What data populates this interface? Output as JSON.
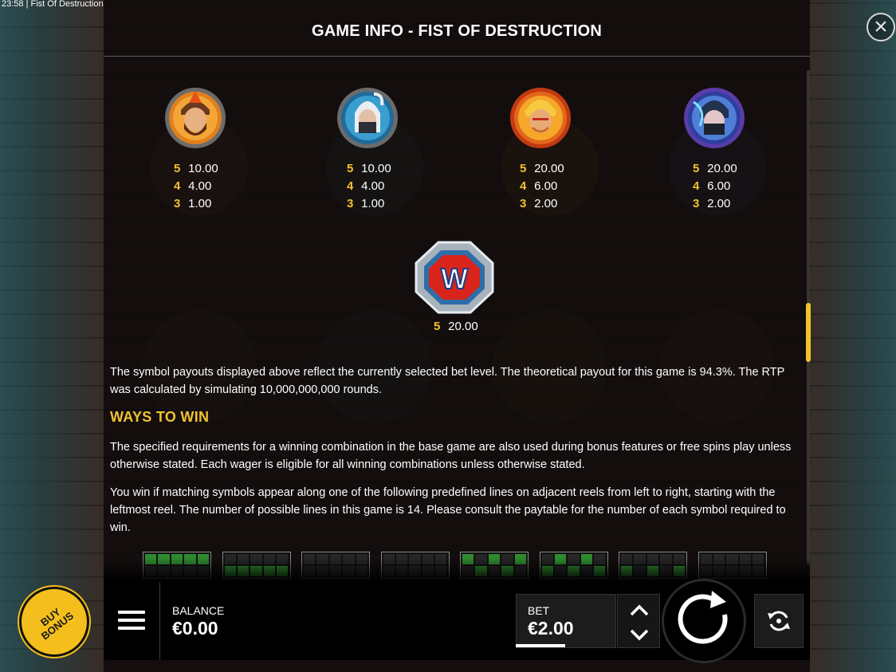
{
  "status_bar": {
    "time": "23:58",
    "game_name": "Fist Of Destruction"
  },
  "header": {
    "title": "GAME INFO - FIST OF DESTRUCTION"
  },
  "paytable": {
    "symbols": [
      {
        "icon": "bearded-fighter-icon",
        "payouts": [
          {
            "count": "5",
            "value": "10.00"
          },
          {
            "count": "4",
            "value": "4.00"
          },
          {
            "count": "3",
            "value": "1.00"
          }
        ]
      },
      {
        "icon": "white-haired-ninja-icon",
        "payouts": [
          {
            "count": "5",
            "value": "10.00"
          },
          {
            "count": "4",
            "value": "4.00"
          },
          {
            "count": "3",
            "value": "1.00"
          }
        ]
      },
      {
        "icon": "blond-brawler-icon",
        "payouts": [
          {
            "count": "5",
            "value": "20.00"
          },
          {
            "count": "4",
            "value": "6.00"
          },
          {
            "count": "3",
            "value": "2.00"
          }
        ]
      },
      {
        "icon": "masked-ninja-icon",
        "payouts": [
          {
            "count": "5",
            "value": "20.00"
          },
          {
            "count": "4",
            "value": "6.00"
          },
          {
            "count": "3",
            "value": "2.00"
          }
        ]
      }
    ],
    "wild": {
      "icon": "wild-w-icon",
      "letter": "W",
      "payouts": [
        {
          "count": "5",
          "value": "20.00"
        }
      ]
    }
  },
  "rtp_text": "The symbol payouts displayed above reflect the currently selected bet level. The theoretical payout for this game is 94.3%. The RTP was calculated by simulating 10,000,000,000 rounds.",
  "ways_to_win": {
    "heading": "WAYS TO WIN",
    "paragraph1": "The specified requirements for a winning combination in the base game are also used during bonus features or free spins play unless otherwise stated. Each wager is eligible for all winning combinations unless otherwise stated.",
    "paragraph2": "You win if matching symbols appear along one of the following predefined lines on adjacent reels from left to right, starting with the leftmost reel. The number of possible lines in this game is 14. Please consult the paytable for the number of each symbol required to win."
  },
  "paylines": [
    [
      [
        1,
        1,
        1,
        1,
        1
      ],
      [
        0,
        0,
        0,
        0,
        0
      ]
    ],
    [
      [
        0,
        0,
        0,
        0,
        0
      ],
      [
        1,
        1,
        1,
        1,
        1
      ]
    ],
    [
      [
        0,
        0,
        0,
        0,
        0
      ],
      [
        0,
        0,
        0,
        0,
        0
      ]
    ],
    [
      [
        0,
        0,
        0,
        0,
        0
      ],
      [
        0,
        0,
        0,
        0,
        0
      ]
    ],
    [
      [
        1,
        0,
        1,
        0,
        1
      ],
      [
        0,
        1,
        0,
        1,
        0
      ]
    ],
    [
      [
        0,
        1,
        0,
        1,
        0
      ],
      [
        1,
        0,
        1,
        0,
        1
      ]
    ],
    [
      [
        0,
        0,
        0,
        0,
        0
      ],
      [
        1,
        0,
        1,
        0,
        1
      ]
    ],
    [
      [
        0,
        0,
        0,
        0,
        0
      ],
      [
        0,
        0,
        0,
        0,
        0
      ]
    ]
  ],
  "controls": {
    "buy_bonus": "BUY BONUS",
    "balance_label": "BALANCE",
    "balance_value": "€0.00",
    "bet_label": "BET",
    "bet_value": "€2.00"
  },
  "colors": {
    "accent": "#f2c230",
    "payline_on": "#2f8a2f"
  }
}
